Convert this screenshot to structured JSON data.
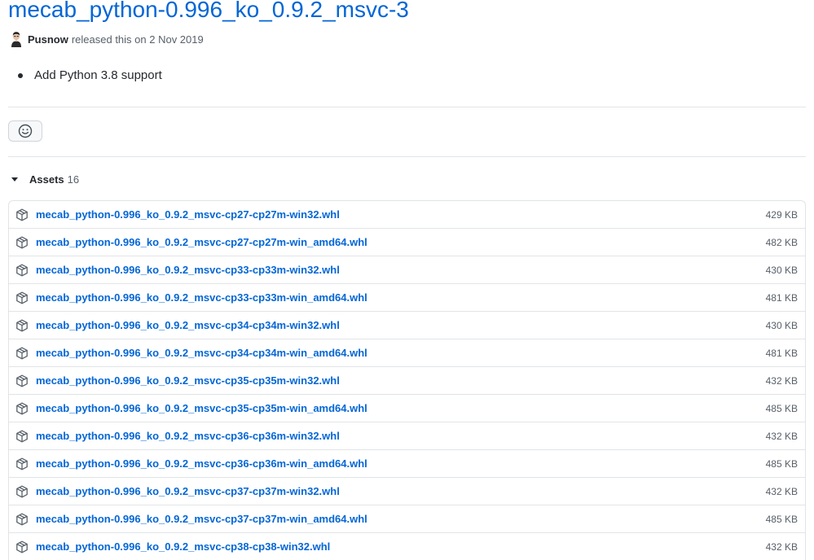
{
  "release": {
    "title": "mecab_python-0.996_ko_0.9.2_msvc-3",
    "author": "Pusnow",
    "released_text": "released this on 2 Nov 2019",
    "notes": [
      "Add Python 3.8 support"
    ]
  },
  "reactions": {
    "icon": "smiley-icon"
  },
  "assets": {
    "label": "Assets",
    "count": "16",
    "items": [
      {
        "name": "mecab_python-0.996_ko_0.9.2_msvc-cp27-cp27m-win32.whl",
        "size": "429 KB"
      },
      {
        "name": "mecab_python-0.996_ko_0.9.2_msvc-cp27-cp27m-win_amd64.whl",
        "size": "482 KB"
      },
      {
        "name": "mecab_python-0.996_ko_0.9.2_msvc-cp33-cp33m-win32.whl",
        "size": "430 KB"
      },
      {
        "name": "mecab_python-0.996_ko_0.9.2_msvc-cp33-cp33m-win_amd64.whl",
        "size": "481 KB"
      },
      {
        "name": "mecab_python-0.996_ko_0.9.2_msvc-cp34-cp34m-win32.whl",
        "size": "430 KB"
      },
      {
        "name": "mecab_python-0.996_ko_0.9.2_msvc-cp34-cp34m-win_amd64.whl",
        "size": "481 KB"
      },
      {
        "name": "mecab_python-0.996_ko_0.9.2_msvc-cp35-cp35m-win32.whl",
        "size": "432 KB"
      },
      {
        "name": "mecab_python-0.996_ko_0.9.2_msvc-cp35-cp35m-win_amd64.whl",
        "size": "485 KB"
      },
      {
        "name": "mecab_python-0.996_ko_0.9.2_msvc-cp36-cp36m-win32.whl",
        "size": "432 KB"
      },
      {
        "name": "mecab_python-0.996_ko_0.9.2_msvc-cp36-cp36m-win_amd64.whl",
        "size": "485 KB"
      },
      {
        "name": "mecab_python-0.996_ko_0.9.2_msvc-cp37-cp37m-win32.whl",
        "size": "432 KB"
      },
      {
        "name": "mecab_python-0.996_ko_0.9.2_msvc-cp37-cp37m-win_amd64.whl",
        "size": "485 KB"
      },
      {
        "name": "mecab_python-0.996_ko_0.9.2_msvc-cp38-cp38-win32.whl",
        "size": "432 KB"
      }
    ]
  },
  "colors": {
    "link": "#0366d6",
    "text": "#24292e",
    "muted": "#586069",
    "border": "#e1e4e8"
  }
}
